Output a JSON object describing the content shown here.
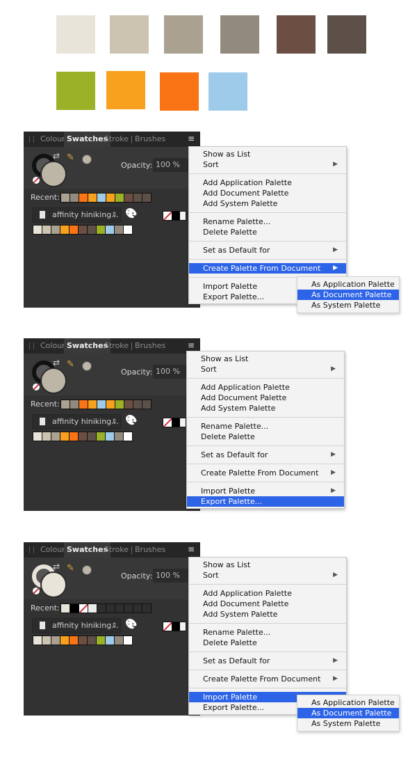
{
  "palette_preview": {
    "row1": [
      "#e9e4da",
      "#cdc3b1",
      "#aaa190",
      "#938a7e",
      "#6c4e42",
      "#5d5049"
    ],
    "row2": [
      "#9ab128",
      "#f7a11e",
      "#fa7415",
      "#9fcbea"
    ]
  },
  "panels": [
    {
      "tabs": [
        "Colour",
        "Swatches",
        "Stroke",
        "Brushes"
      ],
      "active_tab": "Swatches",
      "stroke_color": "#111111",
      "fill_color": "#bdb6a6",
      "opacity_label": "Opacity:",
      "opacity_value": "100 %",
      "recent_label": "Recent:",
      "recent": [
        "#aaa190",
        "#938a7e",
        "#fa7415",
        "#f7a11e",
        "#9fcbea",
        "#f7a11e",
        "#9ab128",
        "#6c4e42",
        "#5d5049",
        "#5d5049"
      ],
      "palette_name": "affinity hiniking...",
      "palette_swatches": [
        "#e9e4da",
        "#cdc3b1",
        "#aaa190",
        "#f7a11e",
        "#fa7415",
        "#6c4e42",
        "#5d5049",
        "#9ab128",
        "#9fcbea",
        "#938a7e",
        "#ffffff"
      ],
      "menu": {
        "groups": [
          [
            {
              "label": "Show as List"
            },
            {
              "label": "Sort",
              "submenu": true
            }
          ],
          [
            {
              "label": "Add Application Palette"
            },
            {
              "label": "Add Document Palette"
            },
            {
              "label": "Add System Palette"
            }
          ],
          [
            {
              "label": "Rename Palette..."
            },
            {
              "label": "Delete Palette"
            }
          ],
          [
            {
              "label": "Set as Default for",
              "submenu": true
            }
          ],
          [
            {
              "label": "Create Palette From Document",
              "submenu": true,
              "highlighted": true
            }
          ],
          [
            {
              "label": "Import Palette"
            },
            {
              "label": "Export Palette..."
            }
          ]
        ]
      },
      "submenu": [
        {
          "label": "As Application Palette"
        },
        {
          "label": "As Document Palette",
          "highlighted": true
        },
        {
          "label": "As System Palette"
        }
      ]
    },
    {
      "tabs": [
        "Colour",
        "Swatches",
        "Stroke",
        "Brushes"
      ],
      "active_tab": "Swatches",
      "stroke_color": "#111111",
      "fill_color": "#bdb6a6",
      "opacity_label": "Opacity:",
      "opacity_value": "100 %",
      "recent_label": "Recent:",
      "recent": [
        "#aaa190",
        "#938a7e",
        "#fa7415",
        "#f7a11e",
        "#9fcbea",
        "#f7a11e",
        "#9ab128",
        "#6c4e42",
        "#5d5049",
        "#5d5049"
      ],
      "palette_name": "affinity hiniking...",
      "palette_swatches": [
        "#e9e4da",
        "#cdc3b1",
        "#aaa190",
        "#f7a11e",
        "#fa7415",
        "#6c4e42",
        "#5d5049",
        "#9ab128",
        "#9fcbea",
        "#938a7e",
        "#ffffff"
      ],
      "menu": {
        "groups": [
          [
            {
              "label": "Show as List"
            },
            {
              "label": "Sort",
              "submenu": true
            }
          ],
          [
            {
              "label": "Add Application Palette"
            },
            {
              "label": "Add Document Palette"
            },
            {
              "label": "Add System Palette"
            }
          ],
          [
            {
              "label": "Rename Palette..."
            },
            {
              "label": "Delete Palette"
            }
          ],
          [
            {
              "label": "Set as Default for",
              "submenu": true
            }
          ],
          [
            {
              "label": "Create Palette From Document",
              "submenu": true
            }
          ],
          [
            {
              "label": "Import Palette",
              "submenu": true
            },
            {
              "label": "Export Palette...",
              "highlighted": true
            }
          ]
        ]
      },
      "submenu": []
    },
    {
      "tabs": [
        "Colour",
        "Swatches",
        "Stroke",
        "Brushes"
      ],
      "active_tab": "Swatches",
      "stroke_color": "#e9e4da",
      "fill_color": "#e9e4da",
      "opacity_label": "Opacity:",
      "opacity_value": "100 %",
      "recent_label": "Recent:",
      "recent": [
        "#e9e4da",
        "#000000",
        "none",
        "#ebebeb",
        "#2e2e2e",
        "#2e2e2e",
        "#2e2e2e",
        "#2e2e2e",
        "#2e2e2e",
        "#2e2e2e"
      ],
      "palette_name": "affinity hiniking...",
      "palette_swatches": [
        "#e9e4da",
        "#cdc3b1",
        "#aaa190",
        "#f7a11e",
        "#fa7415",
        "#6c4e42",
        "#5d5049",
        "#9ab128",
        "#9fcbea",
        "#938a7e",
        "#ffffff"
      ],
      "menu": {
        "groups": [
          [
            {
              "label": "Show as List"
            },
            {
              "label": "Sort",
              "submenu": true
            }
          ],
          [
            {
              "label": "Add Application Palette"
            },
            {
              "label": "Add Document Palette"
            },
            {
              "label": "Add System Palette"
            }
          ],
          [
            {
              "label": "Rename Palette..."
            },
            {
              "label": "Delete Palette"
            }
          ],
          [
            {
              "label": "Set as Default for",
              "submenu": true
            }
          ],
          [
            {
              "label": "Create Palette From Document",
              "submenu": true
            }
          ],
          [
            {
              "label": "Import Palette",
              "highlighted": true
            },
            {
              "label": "Export Palette..."
            }
          ]
        ]
      },
      "submenu": [
        {
          "label": "As Application Palette"
        },
        {
          "label": "As Document Palette",
          "highlighted": true
        },
        {
          "label": "As System Palette"
        }
      ]
    }
  ],
  "icons": {
    "grip": "grip-icon",
    "panel_menu": "hamburger-menu-icon",
    "swap": "swap-arrows-icon",
    "eyedropper": "eyedropper-icon",
    "document": "document-icon",
    "palette": "palette-icon",
    "submenu_arrow": "▶"
  }
}
